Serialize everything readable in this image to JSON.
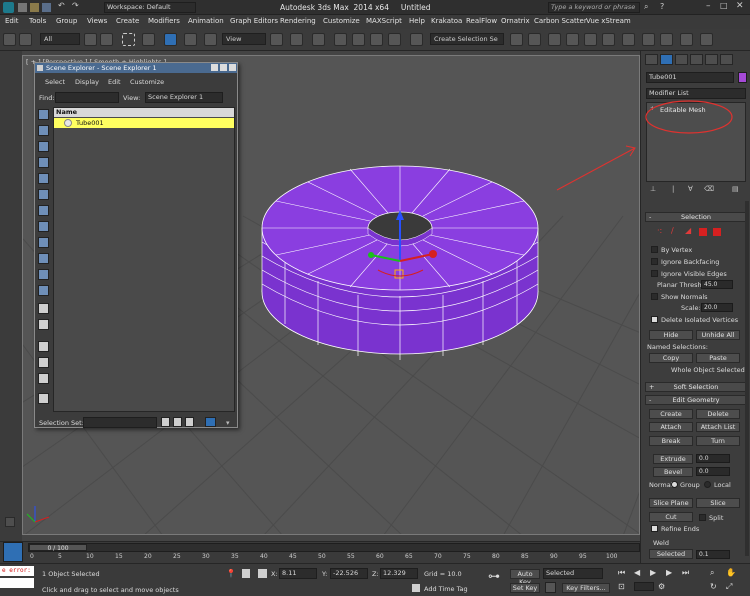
{
  "titlebar": {
    "workspace": "Workspace: Default",
    "title": "Autodesk 3ds Max  2014 x64     Untitled",
    "search_placeholder": "Type a keyword or phrase"
  },
  "menu": [
    "Edit",
    "Tools",
    "Group",
    "Views",
    "Create",
    "Modifiers",
    "Animation",
    "Graph Editors",
    "Rendering",
    "Customize",
    "MAXScript",
    "Help",
    "Krakatoa",
    "RealFlow",
    "Ornatrix",
    "Carbon Scatter",
    "Vue xStream"
  ],
  "toolbar": {
    "selection_filter": "All",
    "reference_coord": "View",
    "named_selection_placeholder": "Create Selection Se"
  },
  "viewport": {
    "label": "[ + ] [Perspective ] [ Smooth + Highlights ]"
  },
  "scene_explorer": {
    "title": "Scene Explorer - Scene Explorer 1",
    "menu": [
      "Select",
      "Display",
      "Edit",
      "Customize"
    ],
    "find_label": "Find:",
    "view_label": "View:",
    "view_value": "Scene Explorer 1",
    "column_name": "Name",
    "items": [
      "Tube001"
    ],
    "selection_set_label": "Selection Set:"
  },
  "command_panel": {
    "object_name": "Tube001",
    "modifier_list": "Modifier List",
    "stack_item": "Editable Mesh",
    "selection": {
      "header": "Selection",
      "by_vertex": "By Vertex",
      "ignore_backfacing": "Ignore Backfacing",
      "ignore_visible_edges": "Ignore Visible Edges",
      "planar_thresh_label": "Planar Thresh:",
      "planar_thresh_value": "45.0",
      "show_normals": "Show Normals",
      "scale_label": "Scale:",
      "scale_value": "20.0",
      "delete_isolated": "Delete Isolated Vertices",
      "hide": "Hide",
      "unhide_all": "Unhide All",
      "named_selections": "Named Selections:",
      "copy": "Copy",
      "paste": "Paste",
      "status": "Whole Object Selected"
    },
    "soft_selection": "Soft Selection",
    "edit_geometry": {
      "header": "Edit Geometry",
      "create": "Create",
      "delete": "Delete",
      "attach": "Attach",
      "attach_list": "Attach List",
      "break": "Break",
      "turn": "Turn",
      "extrude": "Extrude",
      "extrude_value": "0.0",
      "bevel": "Bevel",
      "bevel_value": "0.0",
      "normal_label": "Normal:",
      "group": "Group",
      "local": "Local",
      "slice_plane": "Slice Plane",
      "slice": "Slice",
      "cut": "Cut",
      "split": "Split",
      "refine_ends": "Refine Ends",
      "weld": "Weld",
      "selected": "Selected",
      "weld_value": "0.1"
    }
  },
  "timeline": {
    "frame": "0 / 100",
    "ticks": [
      "0",
      "5",
      "10",
      "15",
      "20",
      "25",
      "30",
      "35",
      "40",
      "45",
      "50",
      "55",
      "60",
      "65",
      "70",
      "75",
      "80",
      "85",
      "90",
      "95",
      "100"
    ]
  },
  "status": {
    "script_error": "e error:",
    "objects_selected": "1 Object Selected",
    "prompt": "Click and drag to select and move objects",
    "x_label": "X:",
    "x_value": "8.11",
    "y_label": "Y:",
    "y_value": "-22.526",
    "z_label": "Z:",
    "z_value": "12.329",
    "grid": "Grid = 10.0",
    "add_time_tag": "Add Time Tag",
    "auto_key": "Auto Key",
    "auto_key_value": "Selected",
    "set_key": "Set Key",
    "key_filters": "Key Filters..."
  },
  "colors": {
    "tube": "#8a3ee0",
    "highlight": "#ffff60",
    "annotation": "#e0322f",
    "swatch": "#a64ad8"
  }
}
